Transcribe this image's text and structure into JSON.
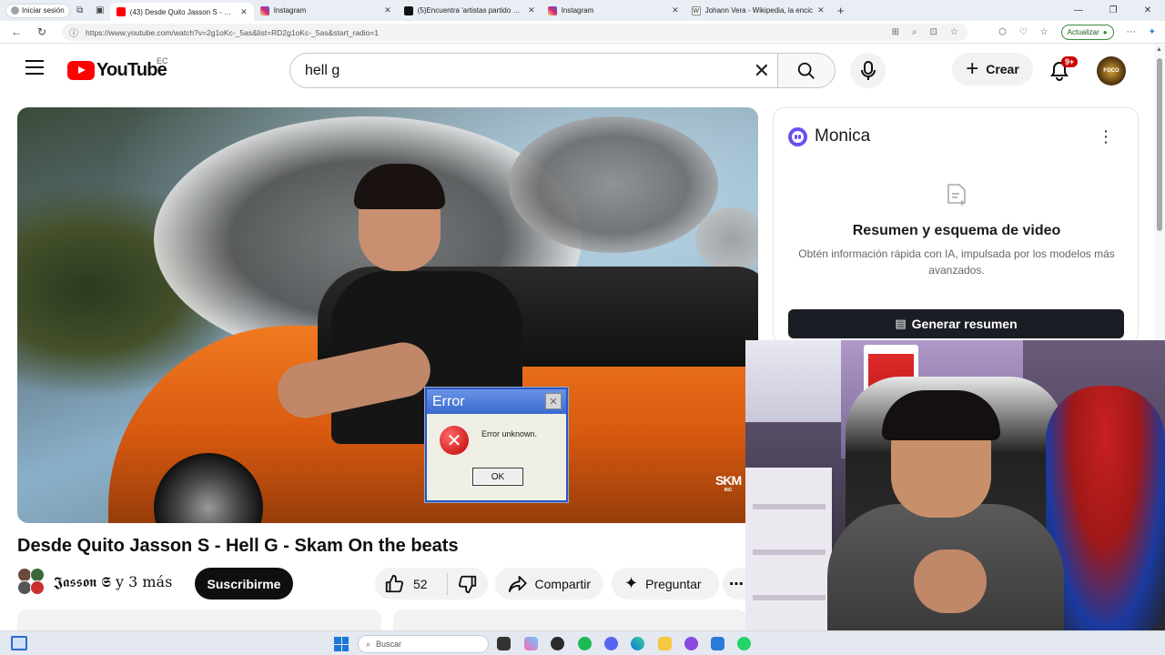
{
  "browser": {
    "signin_label": "Iniciar sesión",
    "tabs": [
      {
        "title": "(43) Desde Quito Jasson S - Hell G",
        "favicon": "youtube-favicon",
        "color": "#ff0000",
        "active": true
      },
      {
        "title": "Instagram",
        "favicon": "instagram-favicon",
        "color": "#d62976",
        "active": false
      },
      {
        "title": "(5)Encuentra 'artistas partido de f",
        "favicon": "tiktok-favicon",
        "color": "#111111",
        "active": false
      },
      {
        "title": "Instagram",
        "favicon": "instagram-favicon",
        "color": "#d62976",
        "active": false
      },
      {
        "title": "Johann Vera - Wikipedia, la encic",
        "favicon": "wikipedia-favicon",
        "color": "#444444",
        "active": false
      }
    ],
    "url": "https://www.youtube.com/watch?v=2g1oKc-_5as&list=RD2g1oKc-_5as&start_radio=1",
    "update_label": "Actualizar"
  },
  "youtube": {
    "logo_text": "YouTube",
    "country_code": "EC",
    "search_value": "hell g",
    "create_label": "Crear",
    "notifications_badge": "9+",
    "avatar_text": "FOCO",
    "video": {
      "error_dialog": {
        "title": "Error",
        "message": "Error unknown.",
        "ok_label": "OK"
      },
      "watermark": "SKM",
      "watermark_sub": "INC"
    },
    "video_title": "Desde Quito Jasson S - Hell G - Skam On the beats",
    "channel_name": "𝕵𝖆𝖘𝖘𝖔𝖓 𝕾 y 3 más",
    "subscribe_label": "Suscribirme",
    "like_count": "52",
    "share_label": "Compartir",
    "ask_label": "Preguntar"
  },
  "monica": {
    "brand": "Monica",
    "title": "Resumen y esquema de video",
    "subtitle": "Obtén información rápida con IA, impulsada por los modelos más avanzados.",
    "button_label": "Generar resumen",
    "accent": "#6b4ef0"
  },
  "taskbar": {
    "search_placeholder": "Buscar"
  }
}
